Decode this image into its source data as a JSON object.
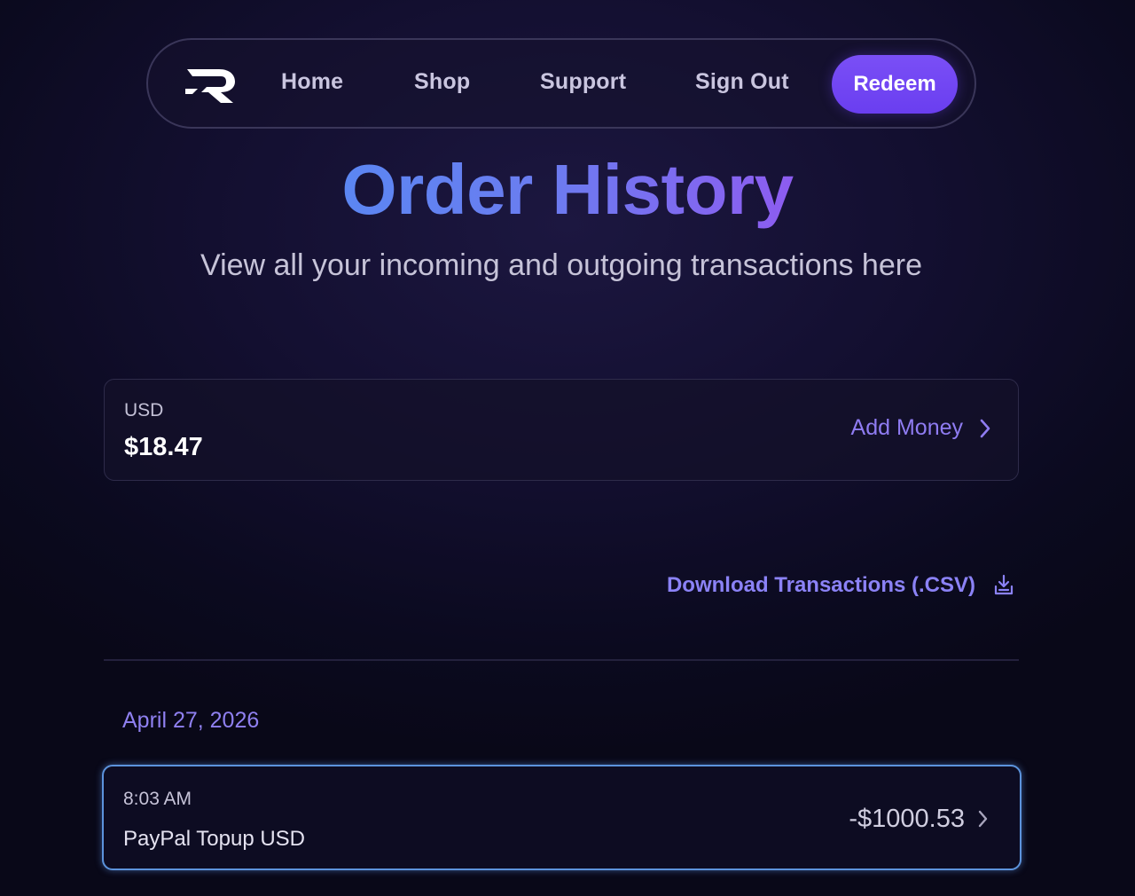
{
  "nav": {
    "logo_icon": "r-logo-icon",
    "links": [
      "Home",
      "Shop",
      "Support",
      "Sign Out"
    ],
    "cta": "Redeem"
  },
  "header": {
    "title": "Order History",
    "subtitle": "View all your incoming and outgoing transactions here"
  },
  "balance": {
    "currency": "USD",
    "amount": "$18.47",
    "action_label": "Add Money",
    "action_icon": "chevron-right-icon"
  },
  "download": {
    "label": "Download Transactions (.CSV)",
    "icon": "download-icon"
  },
  "transactions": {
    "groups": [
      {
        "date": "April 27, 2026",
        "items": [
          {
            "time": "8:03 AM",
            "description": "PayPal Topup USD",
            "amount": "-$1000.53"
          }
        ]
      }
    ]
  },
  "colors": {
    "accent": "#7a4ff6",
    "link": "#8f7cf2",
    "highlight_border": "#5c93dc",
    "background": "#130f30"
  }
}
